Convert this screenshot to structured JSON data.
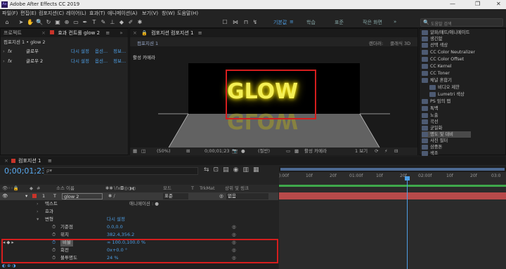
{
  "titlebar": {
    "logo": "Ae",
    "title": "Adobe After Effects CC 2019",
    "min": "—",
    "max": "❐",
    "close": "✕"
  },
  "menu": [
    "파일(F)",
    "편집(E)",
    "컴포지션(C)",
    "레이어(L)",
    "효과(T)",
    "애니메이션(A)",
    "보기(V)",
    "창(W)",
    "도움말(H)"
  ],
  "workspaces": {
    "default": "기본값",
    "learn": "학습",
    "standard": "표준",
    "small": "작은 화면",
    "more": "»"
  },
  "search_help": "도움말 검색",
  "project_panel": {
    "tab_project": "프로젝트",
    "tab_effects": "효과 컨트롤 glow 2",
    "menu": "≡",
    "breadcrumb": "컴포지션 1 • glow 2",
    "effects": [
      {
        "fx": "fx",
        "name": "글로우",
        "reset": "다시 설정",
        "options": "옵션...",
        "about": "정보..."
      },
      {
        "fx": "fx",
        "name": "글로우 2",
        "reset": "다시 설정",
        "options": "옵션...",
        "about": "정보..."
      }
    ]
  },
  "comp_panel": {
    "tab_lock": "🔒",
    "tab": "컴포지션 컴포지션 1",
    "menu": "≡",
    "subtab": "컴포지션 1",
    "renderer_label": "렌더러:",
    "renderer": "클래식 3D",
    "camera": "활성 카메라",
    "glow_text": "GLOW",
    "footer": {
      "zoom": "(50%)",
      "time": "0;00;01;23",
      "quality": "(절반)",
      "view": "활성 카메라",
      "views": "1 보기"
    }
  },
  "effects_presets": {
    "items": [
      "알파/매트/애니메이트",
      "생긴없",
      "선택 색상",
      "CC Color Neutralizer",
      "CC Color Offset",
      "CC Kernel",
      "CC Toner",
      "채널 혼합기",
      "비디오 제한",
      "Lumetri 색상",
      "PS 임의 맵",
      "톡백",
      "노출",
      "곡선",
      "균일화",
      "명도 및 대비",
      "사진 필터",
      "삼중톤",
      "색조"
    ],
    "selected": 15
  },
  "timeline": {
    "close": "×",
    "tab": "컴포지션 1",
    "menu": "≡",
    "timecode": "0;00;01;23",
    "search_placeholder": "ρ▾",
    "headers": {
      "num": "#",
      "source": "소스 이름",
      "mode": "모드",
      "t": "T",
      "trkmat": "TrkMat",
      "parent": "상위 및 링크"
    },
    "layer": {
      "num": "1",
      "type": "T",
      "name": "glow 2",
      "mode": "표준",
      "parent": "없음"
    },
    "groups": [
      {
        "label": "텍스트",
        "extra": "애니메이션 : ●"
      },
      {
        "label": "효과",
        "extra": ""
      },
      {
        "label": "변형",
        "extra": "다시 설정"
      }
    ],
    "props": [
      {
        "label": "기준점",
        "value": "0.0,0.0"
      },
      {
        "label": "위치",
        "value": "382.4,356.2"
      },
      {
        "label": "비율",
        "value": "∞ 100.0,100.0 %"
      },
      {
        "label": "회전",
        "value": "0x+0.0 °"
      },
      {
        "label": "불투명도",
        "value": "24 %"
      }
    ],
    "ruler": [
      "):00f",
      "10f",
      "20f",
      "01:00f",
      "10f",
      "20f",
      "02:00f",
      "10f",
      "20f",
      "03:0"
    ]
  }
}
